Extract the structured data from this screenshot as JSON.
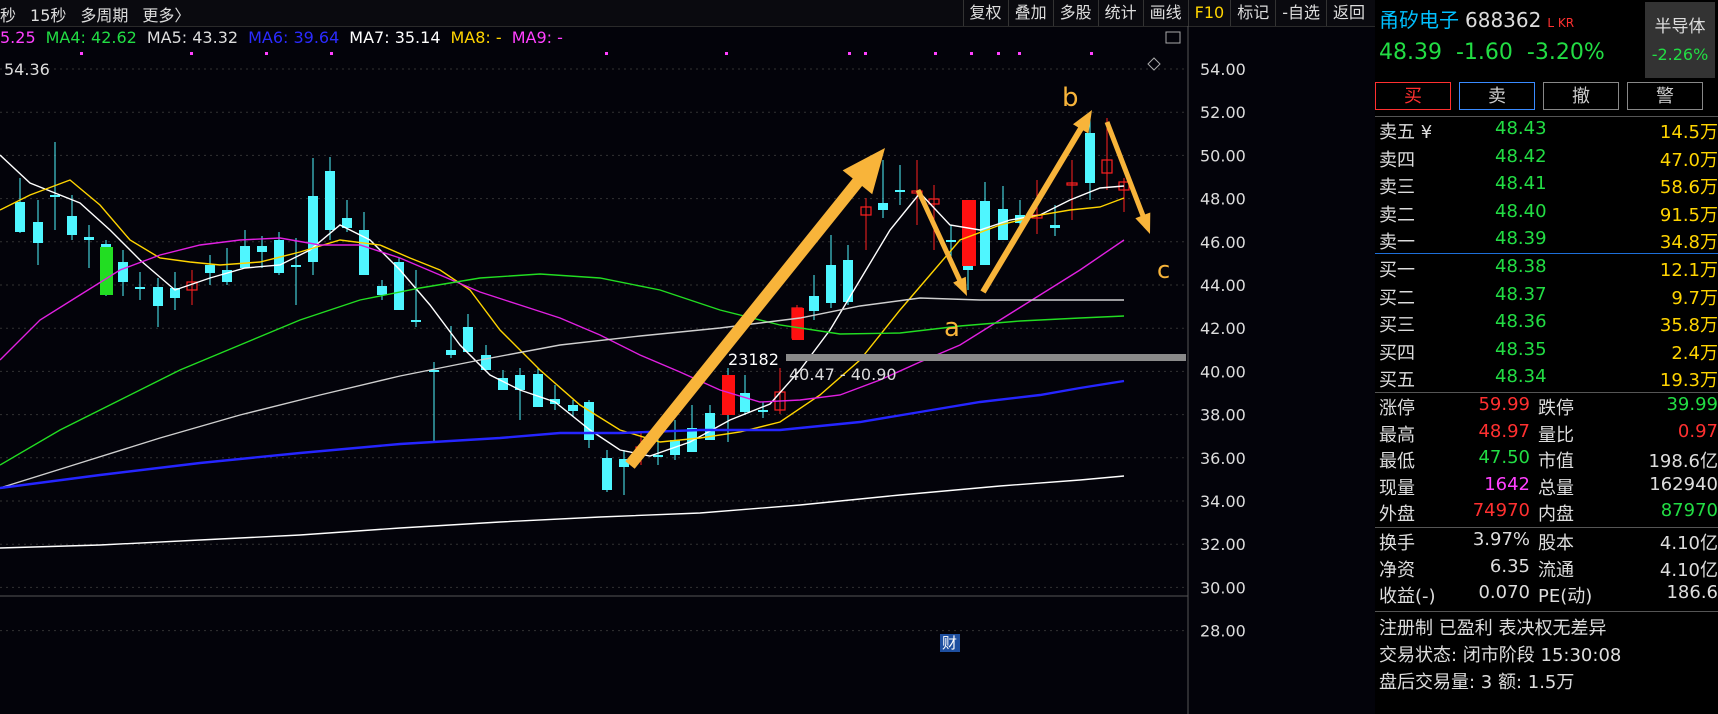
{
  "toolbar": {
    "left_items": [
      "秒",
      "15秒",
      "多周期",
      "更多〉"
    ],
    "right_items": [
      "复权",
      "叠加",
      "多股",
      "统计",
      "画线",
      "F10",
      "标记",
      "-自选",
      "返回"
    ]
  },
  "ma_legend": [
    {
      "text": "5.25",
      "color": "#ff40ff"
    },
    {
      "text": "MA4: 42.62",
      "color": "#22dd44"
    },
    {
      "text": "MA5: 43.32",
      "color": "#dddddd"
    },
    {
      "text": "MA6: 39.64",
      "color": "#2b2bff"
    },
    {
      "text": "MA7: 35.14",
      "color": "#ffffff"
    },
    {
      "text": "MA8: -",
      "color": "#ffd400"
    },
    {
      "text": "MA9: -",
      "color": "#ff40ff"
    }
  ],
  "chart": {
    "type": "candlestick",
    "y_axis": {
      "min": 28,
      "max": 54,
      "ticks": [
        "54.00",
        "52.00",
        "50.00",
        "48.00",
        "46.00",
        "44.00",
        "42.00",
        "40.00",
        "38.00",
        "36.00",
        "34.00",
        "32.00",
        "30.00",
        "28.00"
      ]
    },
    "price_label": "54.36",
    "volume_label": "23182",
    "range_label": "40.47 - 40.90",
    "caiwu_marker": "财",
    "wave_labels": {
      "a": "a",
      "b": "b",
      "c": "c"
    },
    "colors": {
      "up": "#ff2020",
      "down": "#4ff6ff",
      "ma_white": "#ffffff",
      "ma_yellow": "#ffd400",
      "ma_magenta": "#e020e0",
      "ma_green": "#22dd22",
      "ma_gray": "#cfcfcf",
      "ma_blue": "#2525ff",
      "arrow": "#f8b43a"
    }
  },
  "quote": {
    "name": "甬矽电子",
    "code": "688362",
    "tag": "L KR",
    "price": "48.39",
    "change": "-1.60",
    "change_pct": "-3.20%",
    "sector": "半导体",
    "sector_pct": "-2.26%",
    "buttons": [
      "买",
      "卖",
      "撤",
      "警"
    ]
  },
  "asks": [
    {
      "label": "卖五 ¥",
      "price": "48.43",
      "vol": "14.5万"
    },
    {
      "label": "卖四",
      "price": "48.42",
      "vol": "47.0万"
    },
    {
      "label": "卖三",
      "price": "48.41",
      "vol": "58.6万"
    },
    {
      "label": "卖二",
      "price": "48.40",
      "vol": "91.5万"
    },
    {
      "label": "卖一",
      "price": "48.39",
      "vol": "34.8万"
    }
  ],
  "bids": [
    {
      "label": "买一",
      "price": "48.38",
      "vol": "12.1万"
    },
    {
      "label": "买二",
      "price": "48.37",
      "vol": "9.7万"
    },
    {
      "label": "买三",
      "price": "48.36",
      "vol": "35.8万"
    },
    {
      "label": "买四",
      "price": "48.35",
      "vol": "2.4万"
    },
    {
      "label": "买五",
      "price": "48.34",
      "vol": "19.3万"
    }
  ],
  "stats": [
    {
      "l1": "涨停",
      "v1": "59.99",
      "l2": "跌停",
      "v2": "39.99"
    },
    {
      "l1": "最高",
      "v1": "48.97",
      "l2": "量比",
      "v2": "0.97"
    },
    {
      "l1": "最低",
      "v1": "47.50",
      "l2": "市值",
      "v2": "198.6亿"
    },
    {
      "l1": "现量",
      "v1": "1642",
      "l2": "总量",
      "v2": "162940"
    },
    {
      "l1": "外盘",
      "v1": "74970",
      "l2": "内盘",
      "v2": "87970"
    }
  ],
  "stats2": [
    {
      "l1": "换手",
      "v1": "3.97%",
      "l2": "股本",
      "v2": "4.10亿"
    },
    {
      "l1": "净资",
      "v1": "6.35",
      "l2": "流通",
      "v2": "4.10亿"
    },
    {
      "l1": "收益(-)",
      "v1": "0.070",
      "l2": "PE(动)",
      "v2": "186.6"
    }
  ],
  "footer": {
    "line1": "注册制 已盈利 表决权无差异",
    "line2": "交易状态: 闭市阶段 15:30:08",
    "line3": "盘后交易量: 3  额: 1.5万"
  }
}
